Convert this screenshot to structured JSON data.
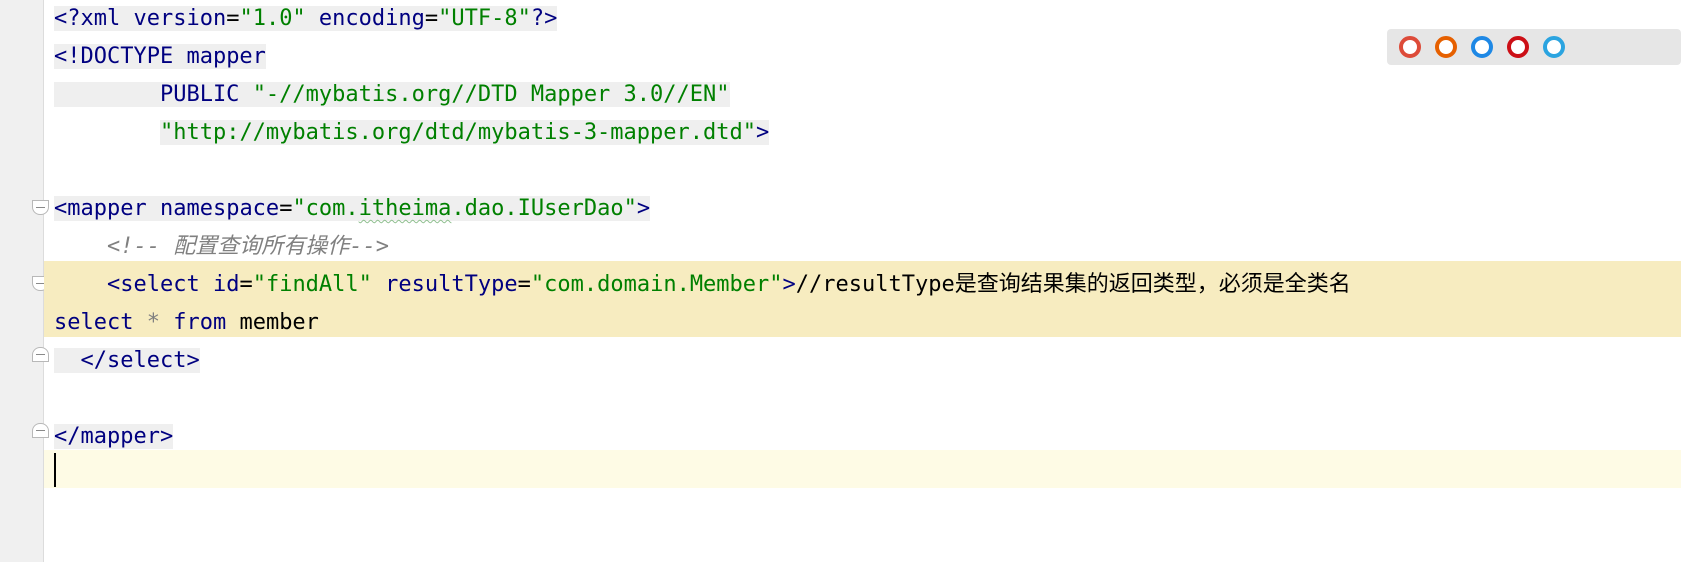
{
  "editor": {
    "lines": [
      {
        "tokens": [
          {
            "t": "<?",
            "c": "t-tag"
          },
          {
            "t": "xml version",
            "c": "t-tag"
          },
          {
            "t": "=",
            "c": "t-txt"
          },
          {
            "t": "\"1.0\"",
            "c": "t-str"
          },
          {
            "t": " encoding",
            "c": "t-tag"
          },
          {
            "t": "=",
            "c": "t-txt"
          },
          {
            "t": "\"UTF-8\"",
            "c": "t-str"
          },
          {
            "t": "?>",
            "c": "t-tag"
          }
        ]
      },
      {
        "tokens": [
          {
            "t": "<!DOCTYPE ",
            "c": "t-tag"
          },
          {
            "t": "mapper",
            "c": "t-tag"
          }
        ]
      },
      {
        "tokens": [
          {
            "t": "        PUBLIC ",
            "c": "t-tag"
          },
          {
            "t": "\"-//mybatis.org//DTD Mapper 3.0//EN\"",
            "c": "t-str"
          }
        ]
      },
      {
        "tokens": [
          {
            "t": "        ",
            "c": "t-txt"
          },
          {
            "t": "\"http://mybatis.org/dtd/mybatis-3-mapper.dtd\"",
            "c": "t-str"
          },
          {
            "t": ">",
            "c": "t-tag"
          }
        ]
      },
      {
        "tokens": []
      },
      {
        "tokens": [
          {
            "t": "<mapper ",
            "c": "t-tag"
          },
          {
            "t": "namespace",
            "c": "t-tag"
          },
          {
            "t": "=",
            "c": "t-txt"
          },
          {
            "t": "\"com.",
            "c": "t-str"
          },
          {
            "t": "itheima",
            "c": "t-str t-wavy"
          },
          {
            "t": ".dao.IUserDao\"",
            "c": "t-str"
          },
          {
            "t": ">",
            "c": "t-tag"
          }
        ]
      },
      {
        "tokens": [
          {
            "t": "    ",
            "c": "t-txt"
          },
          {
            "t": "<!-- 配置查询所有操作-->",
            "c": "t-com"
          }
        ]
      },
      {
        "tokens": [
          {
            "t": "    <select ",
            "c": "t-tag"
          },
          {
            "t": "id",
            "c": "t-tag"
          },
          {
            "t": "=",
            "c": "t-txt"
          },
          {
            "t": "\"findAll\"",
            "c": "t-str"
          },
          {
            "t": " resultType",
            "c": "t-tag"
          },
          {
            "t": "=",
            "c": "t-txt"
          },
          {
            "t": "\"com.domain.Member\"",
            "c": "t-str"
          },
          {
            "t": ">",
            "c": "t-tag"
          },
          {
            "t": "//resultType是查询结果集的返回类型，必须是全类名",
            "c": "t-txt"
          }
        ]
      },
      {
        "tokens": [
          {
            "t": "select ",
            "c": "t-kw"
          },
          {
            "t": "* ",
            "c": "t-com"
          },
          {
            "t": "from ",
            "c": "t-kw"
          },
          {
            "t": "member",
            "c": "t-txt"
          }
        ]
      },
      {
        "tokens": [
          {
            "t": "  </select>",
            "c": "t-tag"
          }
        ]
      },
      {
        "tokens": []
      },
      {
        "tokens": [
          {
            "t": "</mapper>",
            "c": "t-tag"
          }
        ]
      },
      {
        "tokens": []
      }
    ]
  },
  "browser_bar": {
    "icons": [
      {
        "name": "chrome-icon",
        "color": "#dd4b39"
      },
      {
        "name": "firefox-icon",
        "color": "#e66000"
      },
      {
        "name": "safari-icon",
        "color": "#1e88e5"
      },
      {
        "name": "opera-icon",
        "color": "#cc0f16"
      },
      {
        "name": "ie-icon",
        "color": "#2ba4e0"
      }
    ]
  },
  "colors": {
    "highlight_line": "#f7ecc0",
    "caret_line": "#fefbe5",
    "token_background": "#efefef"
  }
}
